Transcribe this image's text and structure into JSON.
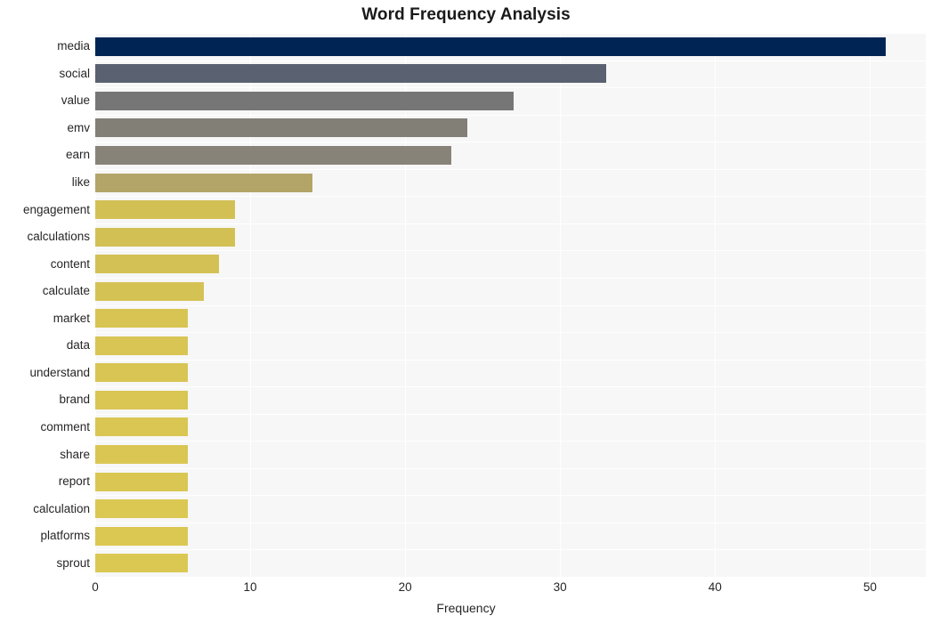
{
  "chart_data": {
    "type": "bar",
    "orientation": "horizontal",
    "title": "Word Frequency Analysis",
    "xlabel": "Frequency",
    "ylabel": "",
    "xlim": [
      0,
      53.6
    ],
    "xticks": [
      0,
      10,
      20,
      30,
      40,
      50
    ],
    "xtick_labels": [
      "0",
      "10",
      "20",
      "30",
      "40",
      "50"
    ],
    "grid": true,
    "grid_color": "#ffffff",
    "plot_background": "#f7f7f7",
    "figure_background": "#ffffff",
    "legend": null,
    "categories": [
      "media",
      "social",
      "value",
      "emv",
      "earn",
      "like",
      "engagement",
      "calculations",
      "content",
      "calculate",
      "market",
      "data",
      "understand",
      "brand",
      "comment",
      "share",
      "report",
      "calculation",
      "platforms",
      "sprout"
    ],
    "values": [
      51,
      33,
      27,
      24,
      23,
      14,
      9,
      9,
      8,
      7,
      6,
      6,
      6,
      6,
      6,
      6,
      6,
      6,
      6,
      6
    ],
    "bar_colors": [
      "#002554",
      "#5a6170",
      "#767676",
      "#827f77",
      "#888379",
      "#b3a568",
      "#d3c055",
      "#d3c055",
      "#d4c155",
      "#d5c254",
      "#d7c453",
      "#d8c553",
      "#d8c553",
      "#d9c653",
      "#d9c653",
      "#dac753",
      "#dac753",
      "#dbc853",
      "#dbc853",
      "#dbc853"
    ]
  }
}
